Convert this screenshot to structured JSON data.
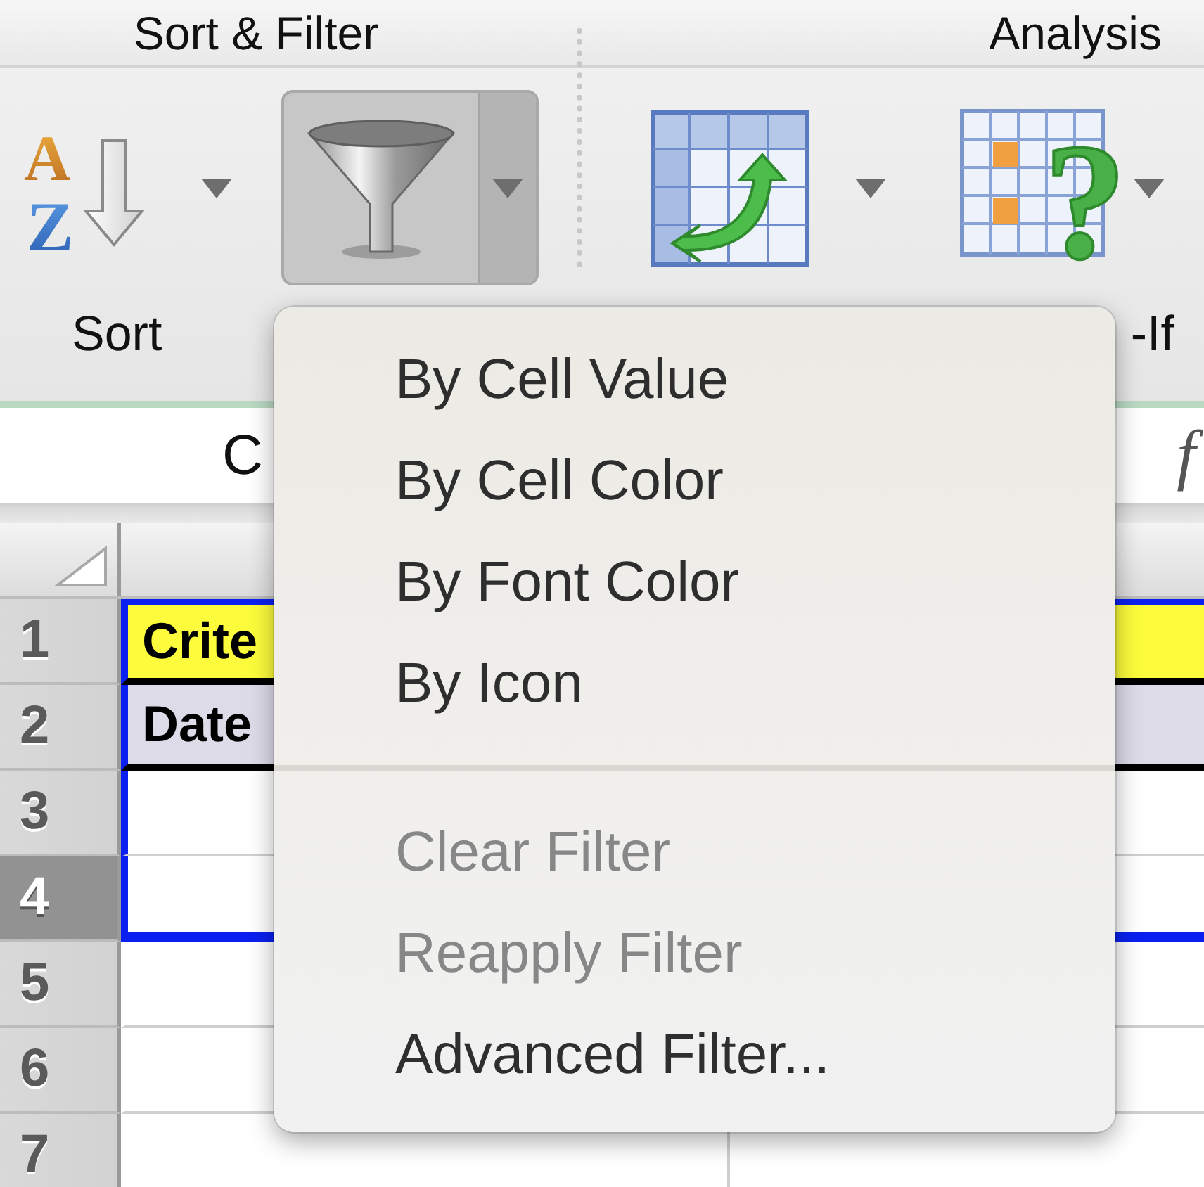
{
  "ribbon": {
    "groups": [
      {
        "title": "Sort & Filter"
      },
      {
        "title": "Analysis"
      }
    ],
    "sort": {
      "label": "Sort",
      "top_letter": "A",
      "bottom_letter": "Z"
    },
    "filter": {
      "pressed": true
    },
    "what_if": {
      "label": "-If",
      "symbol": "?"
    }
  },
  "formula_bar": {
    "name_box": "C",
    "function_mark": "f"
  },
  "sheet": {
    "rows": [
      {
        "header": "1",
        "selected": false,
        "outlined": true,
        "cell": "Crite",
        "color": "#fcfc3c"
      },
      {
        "header": "2",
        "selected": false,
        "outlined": true,
        "cell": "Date",
        "color": "#dedbe9"
      },
      {
        "header": "3",
        "selected": false,
        "outlined": true
      },
      {
        "header": "4",
        "selected": true,
        "outlined": true
      },
      {
        "header": "5",
        "selected": false,
        "outlined": false
      },
      {
        "header": "6",
        "selected": false,
        "outlined": false
      },
      {
        "header": "7",
        "selected": false,
        "outlined": false
      }
    ]
  },
  "filter_menu": {
    "sections": [
      [
        {
          "label": "By Cell Value",
          "disabled": false
        },
        {
          "label": "By Cell Color",
          "disabled": false
        },
        {
          "label": "By Font Color",
          "disabled": false
        },
        {
          "label": "By Icon",
          "disabled": false
        }
      ],
      [
        {
          "label": "Clear Filter",
          "disabled": true
        },
        {
          "label": "Reapply Filter",
          "disabled": true
        },
        {
          "label": "Advanced Filter...",
          "disabled": false
        }
      ]
    ]
  }
}
